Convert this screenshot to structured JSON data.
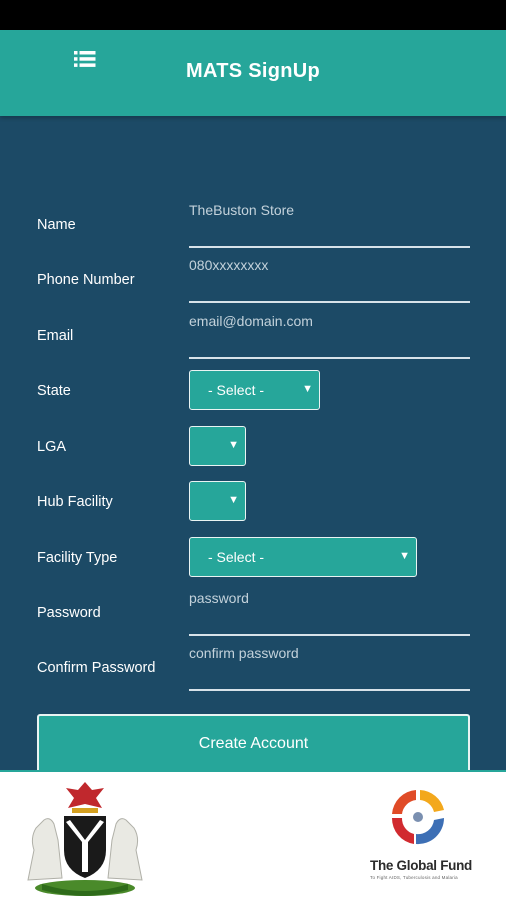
{
  "app_bar": {
    "title": "MATS SignUp",
    "menu_icon": "list-menu-icon"
  },
  "form": {
    "name": {
      "label": "Name",
      "value": "TheBuston Store"
    },
    "phone": {
      "label": "Phone Number",
      "value": "080xxxxxxxx"
    },
    "email": {
      "label": "Email",
      "value": "email@domain.com"
    },
    "state": {
      "label": "State",
      "selected": "- Select -"
    },
    "lga": {
      "label": "LGA",
      "selected": ""
    },
    "hub_facility": {
      "label": "Hub Facility",
      "selected": ""
    },
    "facility_type": {
      "label": "Facility Type",
      "selected": "- Select -"
    },
    "password": {
      "label": "Password",
      "placeholder": "password"
    },
    "confirm_password": {
      "label": "Confirm Password",
      "placeholder": "confirm password"
    },
    "submit_label": "Create Account"
  },
  "footer": {
    "partner_name": "The Global Fund",
    "partner_tagline": "To Fight AIDS, Tuberculosis and Malaria"
  },
  "colors": {
    "app_bar": "#26a69a",
    "background": "#1c4a66",
    "accent": "#26a69a"
  }
}
